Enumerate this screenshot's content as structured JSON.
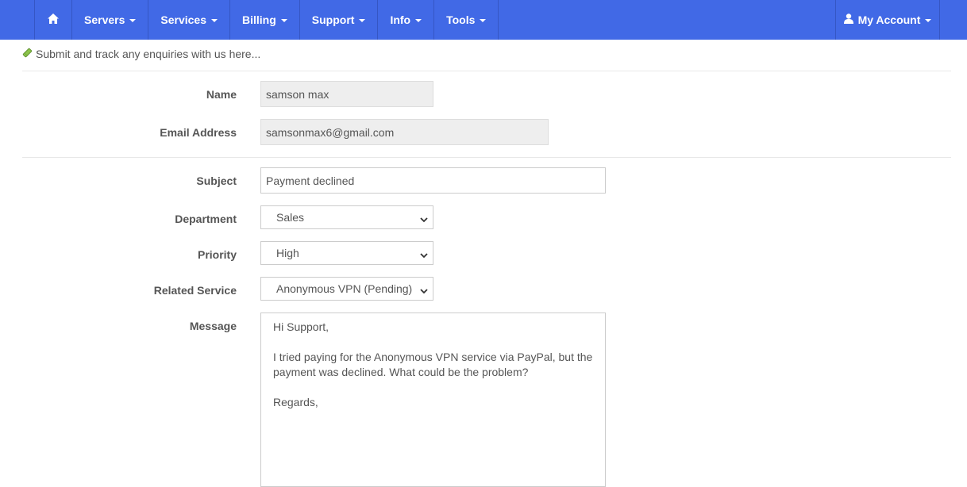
{
  "nav": {
    "items": [
      {
        "label": "Servers"
      },
      {
        "label": "Services"
      },
      {
        "label": "Billing"
      },
      {
        "label": "Support"
      },
      {
        "label": "Info"
      },
      {
        "label": "Tools"
      }
    ],
    "account_label": "My Account",
    "bg_color": "#4169e6"
  },
  "intro": {
    "text": "Submit and track any enquiries with us here..."
  },
  "form": {
    "name_label": "Name",
    "name_value": "samson max",
    "email_label": "Email Address",
    "email_value": "samsonmax6@gmail.com",
    "subject_label": "Subject",
    "subject_value": "Payment declined",
    "department_label": "Department",
    "department_value": "Sales",
    "priority_label": "Priority",
    "priority_value": "High",
    "related_label": "Related Service",
    "related_value": "Anonymous VPN (Pending)",
    "message_label": "Message",
    "message_lines": [
      "Hi Support,",
      "I tried paying for the Anonymous VPN service via PayPal, but the",
      "payment was declined. What could be the problem?",
      "Regards,"
    ]
  }
}
